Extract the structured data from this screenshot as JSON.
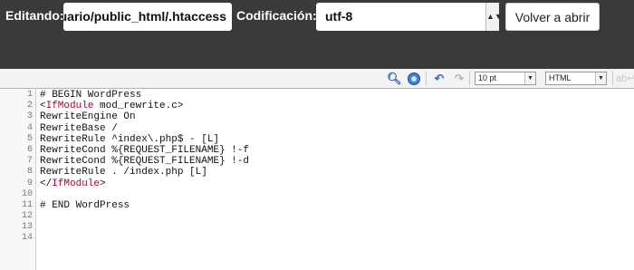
{
  "header": {
    "editing_label": "Editando:",
    "file_path": "/home/usuario/public_html/.htaccess",
    "encoding_label": "Codificación:",
    "encoding_value": "utf-8",
    "reopen_button": "Volver a abrir"
  },
  "toolbar": {
    "icons": [
      "search-icon",
      "goto-line-icon",
      "undo-icon",
      "redo-icon",
      "word-wrap-icon"
    ],
    "font_size": "10 pt",
    "syntax": "HTML"
  },
  "editor": {
    "tag_color": "#b0002a",
    "lines": [
      {
        "num": "1",
        "segs": [
          {
            "t": "# BEGIN WordPress"
          }
        ]
      },
      {
        "num": "2",
        "segs": [
          {
            "t": "<"
          },
          {
            "t": "IfModule",
            "tag": true
          },
          {
            "t": " mod_rewrite.c>"
          }
        ]
      },
      {
        "num": "3",
        "segs": [
          {
            "t": "RewriteEngine On"
          }
        ]
      },
      {
        "num": "4",
        "segs": [
          {
            "t": "RewriteBase /"
          }
        ]
      },
      {
        "num": "5",
        "segs": [
          {
            "t": "RewriteRule ^index\\.php$ - [L]"
          }
        ]
      },
      {
        "num": "6",
        "segs": [
          {
            "t": "RewriteCond %{REQUEST_FILENAME} !-f"
          }
        ]
      },
      {
        "num": "7",
        "segs": [
          {
            "t": "RewriteCond %{REQUEST_FILENAME} !-d"
          }
        ]
      },
      {
        "num": "8",
        "segs": [
          {
            "t": "RewriteRule . /index.php [L]"
          }
        ]
      },
      {
        "num": "9",
        "segs": [
          {
            "t": "</"
          },
          {
            "t": "IfModule",
            "tag": true
          },
          {
            "t": ">"
          }
        ]
      },
      {
        "num": "10",
        "segs": [
          {
            "t": ""
          }
        ]
      },
      {
        "num": "11",
        "segs": [
          {
            "t": "# END WordPress"
          }
        ]
      },
      {
        "num": "12",
        "segs": [
          {
            "t": ""
          }
        ]
      },
      {
        "num": "13",
        "segs": [
          {
            "t": ""
          }
        ]
      },
      {
        "num": "14",
        "segs": [
          {
            "t": ""
          }
        ]
      }
    ]
  }
}
